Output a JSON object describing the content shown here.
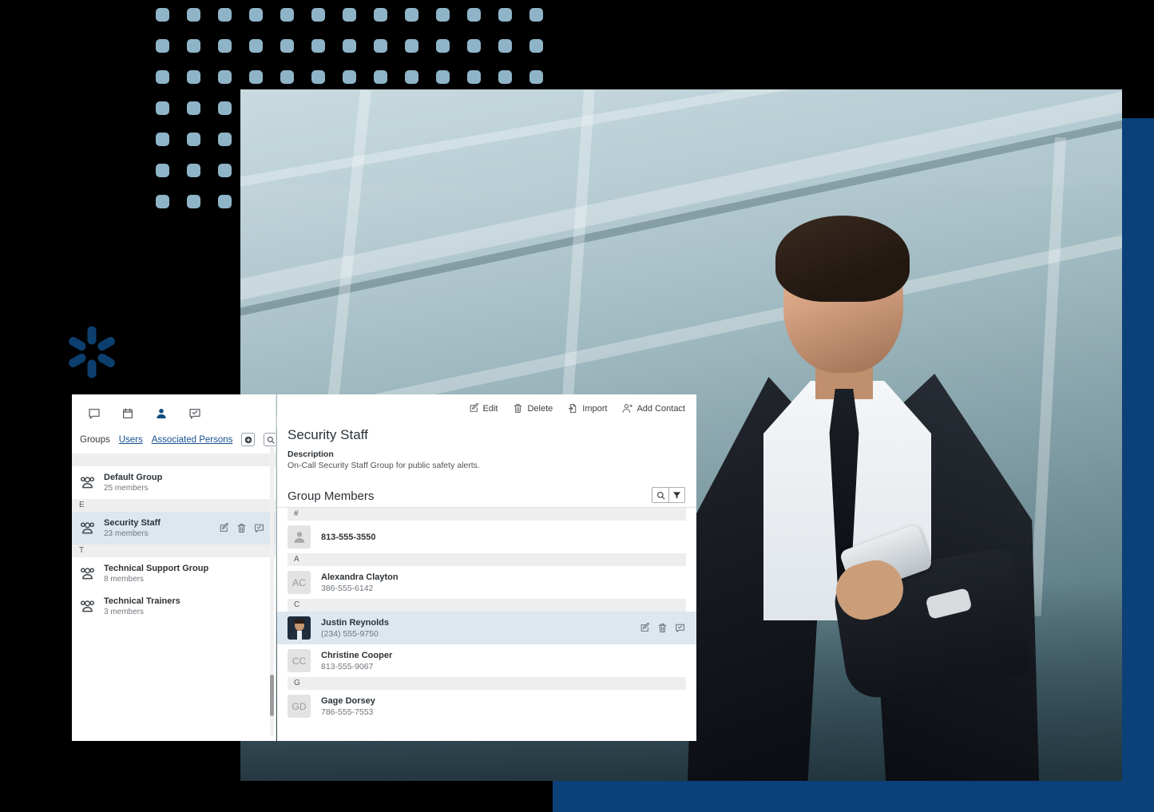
{
  "colors": {
    "dot": "#8fb4c8",
    "accent_blue": "#0b4178",
    "logo_blue": "#0d3f6e",
    "selection": "#dce7f0",
    "link": "#17508e"
  },
  "decor": {
    "dot_grid_name": "dot-grid-pattern",
    "logo_name": "starburst-logo",
    "accent_right_name": "blue-accent-bar-right",
    "accent_bottom_name": "blue-accent-bar-bottom",
    "hero_name": "hero-photo-businessman-with-phone"
  },
  "sidebar": {
    "nav_icons": [
      {
        "name": "chat-icon",
        "label": "Chat",
        "active": false
      },
      {
        "name": "calendar-icon",
        "label": "Calendar",
        "active": false
      },
      {
        "name": "contacts-icon",
        "label": "Contacts",
        "active": true
      },
      {
        "name": "tasks-icon",
        "label": "Tasks",
        "active": false
      }
    ],
    "tabs": [
      {
        "label": "Groups",
        "link": false
      },
      {
        "label": "Users",
        "link": true
      },
      {
        "label": "Associated Persons",
        "link": true
      }
    ],
    "add_button": "add-group-button",
    "search_button": "search-groups-button",
    "sections": [
      {
        "letter": "",
        "rows": [
          {
            "name": "Default Group",
            "count": "25 members",
            "selected": false
          }
        ]
      },
      {
        "letter": "E",
        "rows": [
          {
            "name": "Security Staff",
            "count": "23 members",
            "selected": true
          }
        ]
      },
      {
        "letter": "T",
        "rows": [
          {
            "name": "Technical Support Group",
            "count": "8 members",
            "selected": false
          },
          {
            "name": "Technical Trainers",
            "count": "3 members",
            "selected": false
          }
        ]
      }
    ]
  },
  "detail": {
    "toolbar": [
      {
        "label": "Edit",
        "icon": "edit-icon"
      },
      {
        "label": "Delete",
        "icon": "trash-icon"
      },
      {
        "label": "Import",
        "icon": "import-icon"
      },
      {
        "label": "Add Contact",
        "icon": "add-contact-icon"
      }
    ],
    "title": "Security Staff",
    "description_label": "Description",
    "description_text": "On-Call Security Staff Group for public safety alerts.",
    "members_title": "Group Members",
    "members_search_icon": "search-icon",
    "members_filter_icon": "filter-icon",
    "member_sections": [
      {
        "letter": "#",
        "members": [
          {
            "name": "813-555-3550",
            "phone": "",
            "initials": "",
            "avatar": "placeholder",
            "selected": false
          }
        ]
      },
      {
        "letter": "A",
        "members": [
          {
            "name": "Alexandra Clayton",
            "phone": "386-555-6142",
            "initials": "AC",
            "avatar": "initials",
            "selected": false
          }
        ]
      },
      {
        "letter": "C",
        "members": [
          {
            "name": "Justin Reynolds",
            "phone": "(234) 555-9750",
            "initials": "",
            "avatar": "photo",
            "selected": true
          },
          {
            "name": "Christine Cooper",
            "phone": "813-555-9067",
            "initials": "CC",
            "avatar": "initials",
            "selected": false
          }
        ]
      },
      {
        "letter": "G",
        "members": [
          {
            "name": "Gage Dorsey",
            "phone": "786-555-7553",
            "initials": "GD",
            "avatar": "initials",
            "selected": false
          }
        ]
      }
    ],
    "row_actions": [
      {
        "icon": "edit-icon",
        "label": "Edit"
      },
      {
        "icon": "trash-icon",
        "label": "Delete"
      },
      {
        "icon": "message-icon",
        "label": "Message"
      }
    ]
  }
}
